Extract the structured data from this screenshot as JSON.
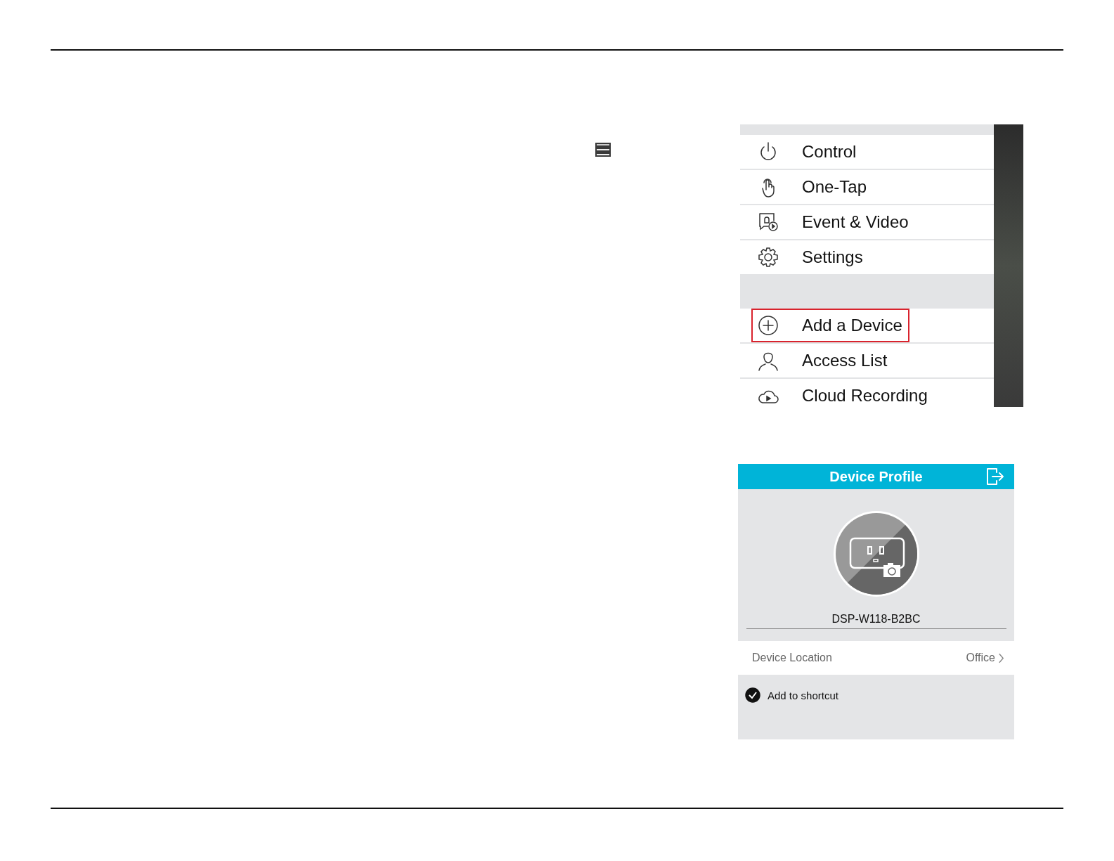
{
  "menu": {
    "groups": [
      {
        "items": [
          {
            "label": "Control",
            "highlighted": false
          },
          {
            "label": "One-Tap",
            "highlighted": false
          },
          {
            "label": "Event & Video",
            "highlighted": false
          },
          {
            "label": "Settings",
            "highlighted": false
          }
        ]
      },
      {
        "items": [
          {
            "label": "Add a Device",
            "highlighted": true
          },
          {
            "label": "Access List",
            "highlighted": false
          },
          {
            "label": "Cloud Recording",
            "highlighted": false
          }
        ]
      }
    ]
  },
  "device_profile": {
    "title": "Device Profile",
    "device_name": "DSP-W118-B2BC",
    "location_label": "Device Location",
    "location_value": "Office",
    "shortcut": {
      "label": "Add to shortcut",
      "checked": true
    }
  }
}
